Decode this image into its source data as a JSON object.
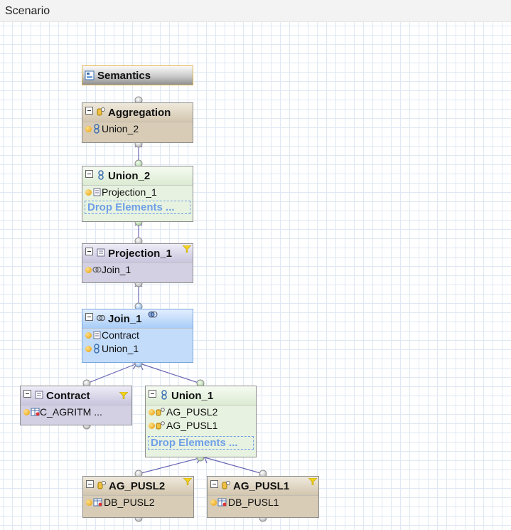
{
  "window": {
    "title": "Scenario"
  },
  "nodes": {
    "semantics": {
      "title": "Semantics"
    },
    "aggregation": {
      "title": "Aggregation",
      "rows": [
        "Union_2"
      ]
    },
    "union2": {
      "title": "Union_2",
      "rows": [
        "Projection_1"
      ],
      "drop": "Drop Elements ..."
    },
    "projection1": {
      "title": "Projection_1",
      "rows": [
        "Join_1"
      ]
    },
    "join1": {
      "title": "Join_1",
      "rows": [
        "Contract",
        "Union_1"
      ]
    },
    "contract": {
      "title": "Contract",
      "rows": [
        "C_AGRITM ..."
      ]
    },
    "union1": {
      "title": "Union_1",
      "rows": [
        "AG_PUSL2",
        "AG_PUSL1"
      ],
      "drop": "Drop Elements ..."
    },
    "agpusl2": {
      "title": "AG_PUSL2",
      "rows": [
        "DB_PUSL2"
      ]
    },
    "agpusl1": {
      "title": "AG_PUSL1",
      "rows": [
        "DB_PUSL1"
      ]
    }
  },
  "icons": {
    "semantics": "semantics-icon",
    "aggregation": "aggregation-icon",
    "union": "union-icon",
    "projection": "projection-icon",
    "join": "join-icon",
    "table": "table-icon",
    "filter": "filter-icon"
  },
  "colors": {
    "grid": "#dfe8f3",
    "link": "#6a67b4",
    "drop_text": "#6f9fe6",
    "join_fill": "#c3dcfa",
    "union_fill": "#e7f2e0",
    "projection_fill": "#d3d0e4",
    "aggregation_fill": "#d8ccb6"
  }
}
